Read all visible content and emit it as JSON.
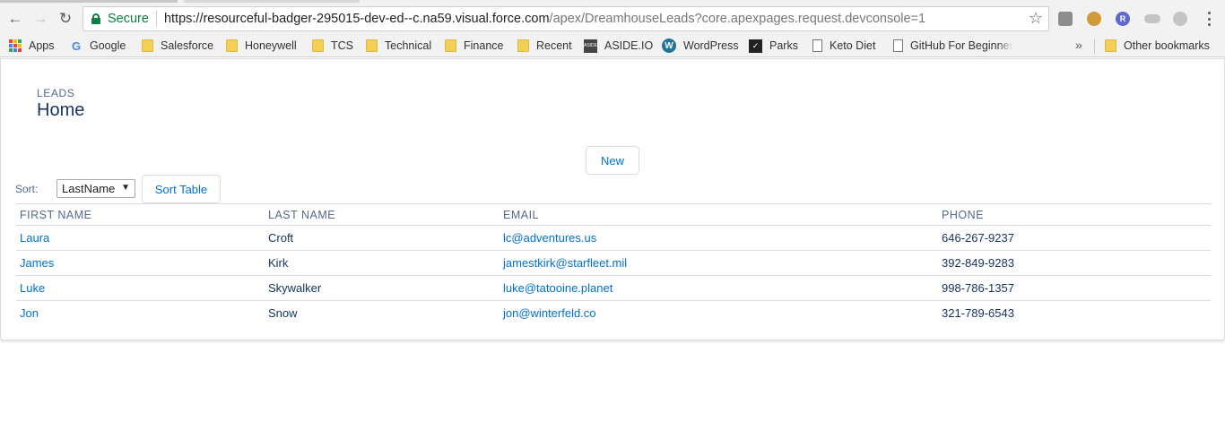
{
  "browser": {
    "secure_label": "Secure",
    "url_main": "https://resourceful-badger-295015-dev-ed--c.na59.visual.force.com",
    "url_path": "/apex/DreamhouseLeads?core.apexpages.request.devconsole=1",
    "extensions": [
      "generic-extension-icon",
      "cookie-icon",
      "r-extension-icon",
      "cloud-icon",
      "toggle-extension-icon"
    ],
    "ext3_letter": "R",
    "aside_icon_text": "ASIDE",
    "wordpress_icon_text": "W",
    "parks_icon_text": "✓"
  },
  "bookmarks": {
    "apps": "Apps",
    "google": "Google",
    "items": [
      "Salesforce",
      "Honeywell",
      "TCS",
      "Technical",
      "Finance",
      "Recent",
      "ASIDE.IO",
      "WordPress",
      "Parks",
      "Keto Diet",
      "GitHub For Beginner"
    ],
    "more": "»",
    "other": "Other bookmarks"
  },
  "page": {
    "kicker": "LEADS",
    "title": "Home",
    "new_button": "New",
    "sort_label": "Sort:",
    "sort_value": "LastName",
    "sort_button": "Sort Table"
  },
  "table": {
    "headers": [
      "FIRST NAME",
      "LAST NAME",
      "EMAIL",
      "PHONE"
    ],
    "rows": [
      {
        "first": "Laura",
        "last": "Croft",
        "email": "lc@adventures.us",
        "phone": "646-267-9237"
      },
      {
        "first": "James",
        "last": "Kirk",
        "email": "jamestkirk@starfleet.mil",
        "phone": "392-849-9283"
      },
      {
        "first": "Luke",
        "last": "Skywalker",
        "email": "luke@tatooine.planet",
        "phone": "998-786-1357"
      },
      {
        "first": "Jon",
        "last": "Snow",
        "email": "jon@winterfeld.co",
        "phone": "321-789-6543"
      }
    ]
  },
  "colors": {
    "link": "#0070d2",
    "heading": "#16325c",
    "muted": "#54698d",
    "secure": "#0b8043"
  }
}
